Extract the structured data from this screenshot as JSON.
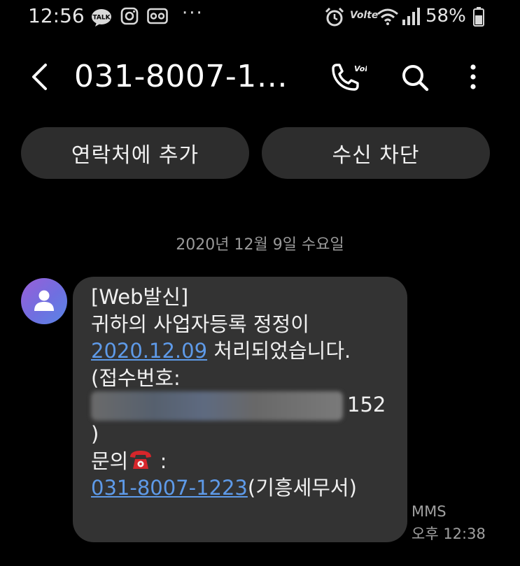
{
  "status_bar": {
    "time": "12:56",
    "talk_badge": "TALK",
    "more_notifications": "···",
    "volte_label": "Volte",
    "battery_percent": "58%"
  },
  "app_bar": {
    "title": "031-8007-1…",
    "call_icon": "phone-volte-icon",
    "call_badge": "Volte",
    "search_icon": "search-icon",
    "menu_icon": "more-vert-icon"
  },
  "actions": {
    "add_contact": "연락처에 추가",
    "block": "수신 차단"
  },
  "conversation": {
    "date_divider": "2020년 12월 9일 수요일",
    "message": {
      "line1": "[Web발신]",
      "line2": "귀하의 사업자등록 정정이",
      "date_link": "2020.12.09",
      "line3_rest": " 처리되었습니다.",
      "line4": "(접수번호:",
      "receipt_suffix": "152",
      "line6": ")",
      "inquiry_label": "문의",
      "inquiry_colon": " :",
      "phone_link": "031-8007-1223",
      "phone_suffix": "(기흥세무서)"
    },
    "meta": {
      "type": "MMS",
      "time": "오후 12:38"
    }
  },
  "colors": {
    "background": "#000000",
    "bubble": "#333333",
    "button": "#2d2d2d",
    "link": "#5e9ae8",
    "muted_text": "#9a9a9a"
  }
}
